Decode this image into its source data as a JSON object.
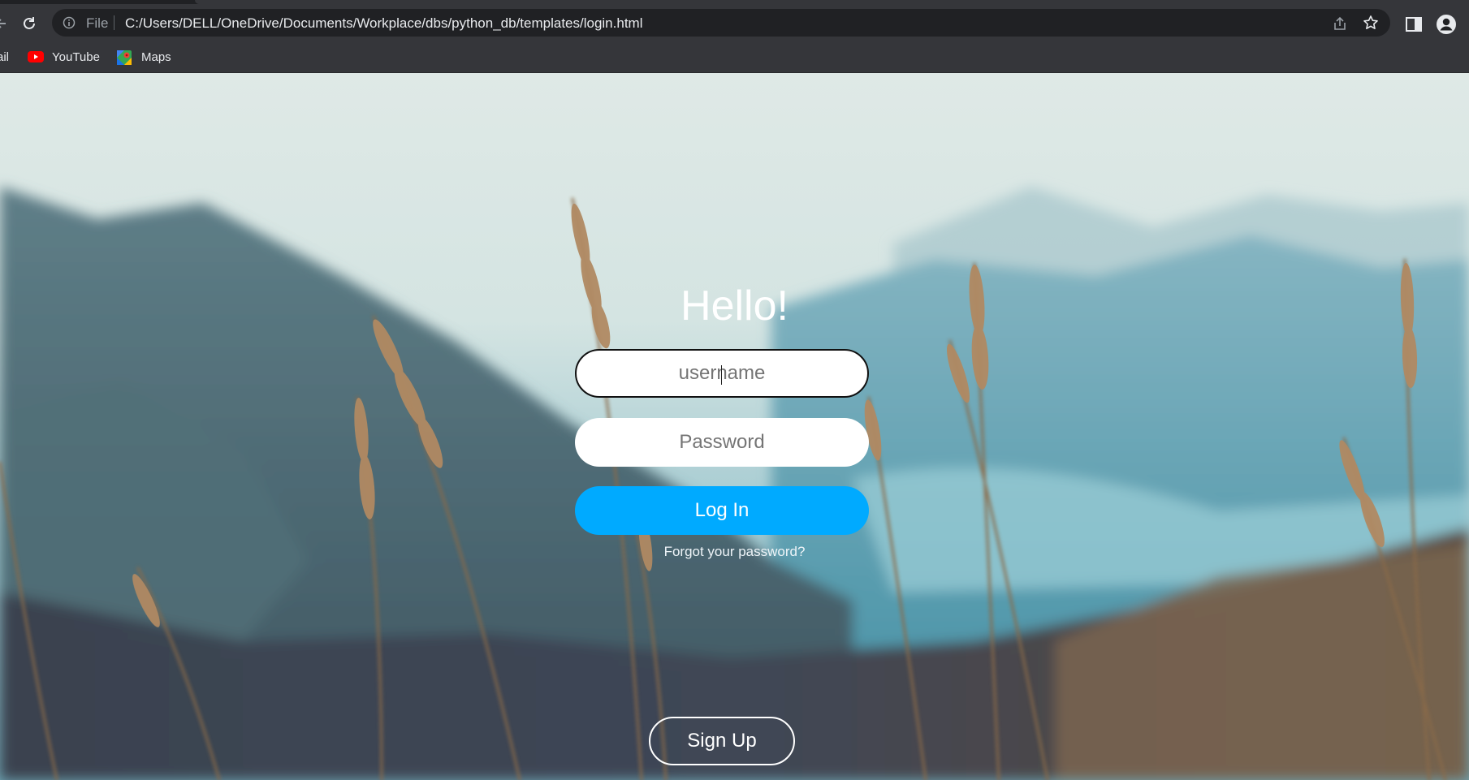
{
  "browser": {
    "address_scheme": "File",
    "address_url": "C:/Users/DELL/OneDrive/Documents/Workplace/dbs/python_db/templates/login.html",
    "bookmarks": [
      {
        "label": "ail",
        "icon": "gmail-icon"
      },
      {
        "label": "YouTube",
        "icon": "youtube-icon"
      },
      {
        "label": "Maps",
        "icon": "maps-icon"
      }
    ]
  },
  "login": {
    "heading": "Hello!",
    "username_placeholder": "username",
    "password_placeholder": "Password",
    "login_label": "Log In",
    "forgot_label": "Forgot your password?",
    "signup_label": "Sign Up"
  },
  "colors": {
    "login_button": "#00aaff",
    "chrome_toolbar": "#35363a",
    "omnibox": "#202124"
  }
}
